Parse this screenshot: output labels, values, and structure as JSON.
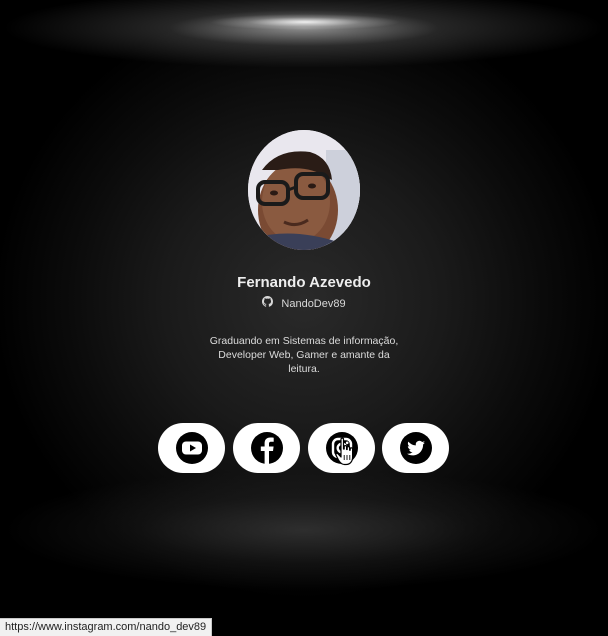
{
  "profile": {
    "name": "Fernando Azevedo",
    "handle": "NandoDev89",
    "bio": "Graduando em Sistemas de informação, Developer Web, Gamer e amante da leitura."
  },
  "socials": [
    {
      "icon": "youtube-icon"
    },
    {
      "icon": "facebook-icon"
    },
    {
      "icon": "instagram-icon"
    },
    {
      "icon": "twitter-icon"
    }
  ],
  "status_bar": {
    "url": "https://www.instagram.com/nando_dev89"
  },
  "colors": {
    "background": "#000000",
    "button": "#ffffff",
    "icon": "#000000",
    "text": "#e8e8e8"
  }
}
